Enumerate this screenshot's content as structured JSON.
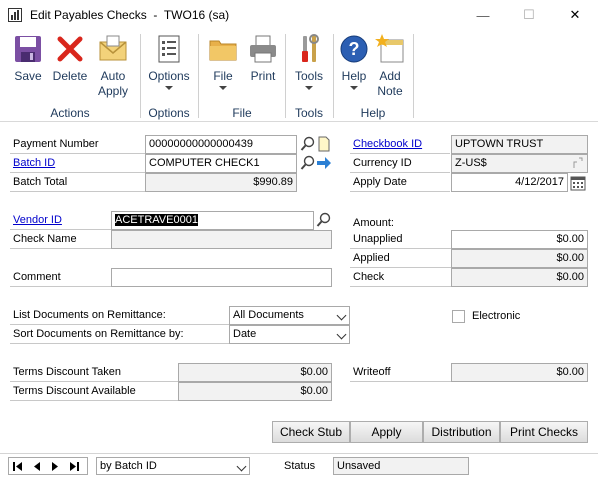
{
  "window": {
    "title": "Edit Payables Checks  -  TWO16 (sa)",
    "minimize_glyph": "—",
    "maximize_glyph": "☐",
    "close_glyph": "✕"
  },
  "ribbon": {
    "buttons": {
      "save": "Save",
      "delete": "Delete",
      "auto_apply": "Auto\nApply",
      "options": "Options",
      "file": "File",
      "print": "Print",
      "tools": "Tools",
      "help": "Help",
      "add_note": "Add\nNote"
    },
    "groups": {
      "actions": "Actions",
      "options": "Options",
      "file": "File",
      "tools": "Tools",
      "help": "Help"
    }
  },
  "form": {
    "payment_number_label": "Payment Number",
    "payment_number": "00000000000000439",
    "batch_id_label": "Batch ID",
    "batch_id": "COMPUTER CHECK1",
    "batch_total_label": "Batch Total",
    "batch_total": "$990.89",
    "checkbook_id_label": "Checkbook ID",
    "checkbook_id": "UPTOWN TRUST",
    "currency_id_label": "Currency ID",
    "currency_id": "Z-US$",
    "apply_date_label": "Apply Date",
    "apply_date": "4/12/2017",
    "vendor_id_label": "Vendor ID",
    "vendor_id": "ACETRAVE0001",
    "check_name_label": "Check Name",
    "check_name": "",
    "comment_label": "Comment",
    "comment": "",
    "amount_label": "Amount:",
    "unapplied_label": "Unapplied",
    "unapplied": "$0.00",
    "applied_label": "Applied",
    "applied": "$0.00",
    "check_label": "Check",
    "check": "$0.00",
    "list_docs_label": "List Documents on Remittance:",
    "list_docs_value": "All Documents",
    "sort_docs_label": "Sort Documents on Remittance by:",
    "sort_docs_value": "Date",
    "electronic_label": "Electronic",
    "electronic_checked": false,
    "terms_taken_label": "Terms Discount Taken",
    "terms_taken": "$0.00",
    "terms_available_label": "Terms Discount Available",
    "terms_available": "$0.00",
    "writeoff_label": "Writeoff",
    "writeoff": "$0.00"
  },
  "actions": {
    "check_stub": "Check Stub",
    "apply": "Apply",
    "distribution": "Distribution",
    "print_checks": "Print Checks"
  },
  "statusbar": {
    "sort_by": "by Batch ID",
    "status_label": "Status",
    "status_value": "Unsaved"
  },
  "colors": {
    "link": "#0000cc",
    "ribbon_text": "#1e395b"
  }
}
